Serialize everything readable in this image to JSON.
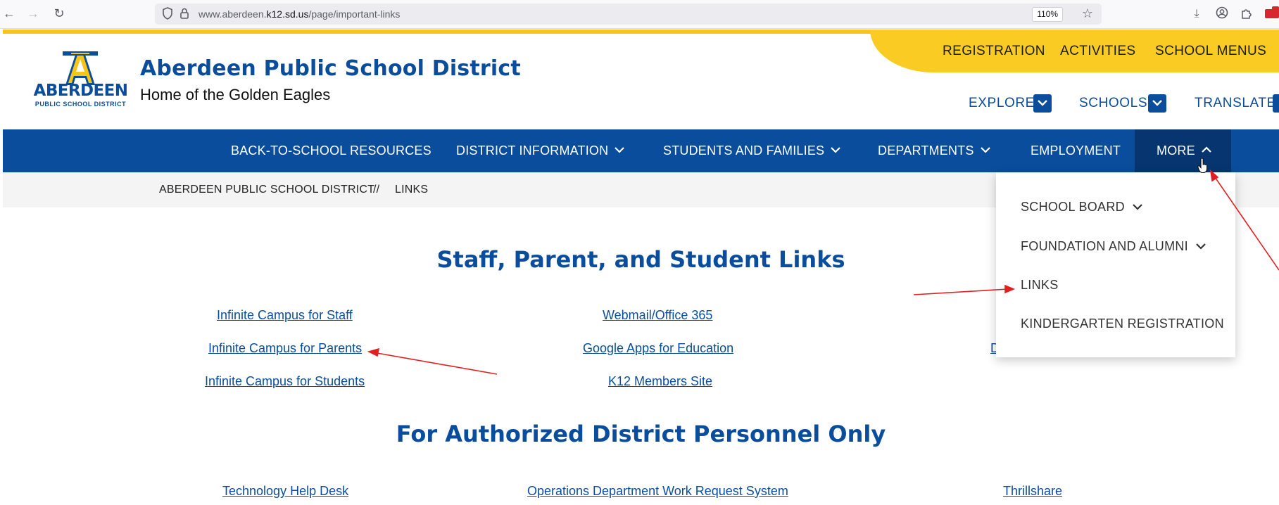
{
  "browser": {
    "url_prefix": "www.aberdeen.",
    "url_domain": "k12.sd.us",
    "url_path": "/page/important-links",
    "zoom": "110%"
  },
  "utility_nav": [
    "REGISTRATION",
    "ACTIVITIES",
    "SCHOOL MENUS"
  ],
  "logo": {
    "word": "ABERDEEN",
    "sub": "PUBLIC SCHOOL DISTRICT",
    "letter": "A"
  },
  "header": {
    "title": "Aberdeen Public School District",
    "tagline": "Home of the Golden Eagles"
  },
  "secondary_nav": [
    "EXPLORE",
    "SCHOOLS",
    "TRANSLATE"
  ],
  "main_nav": [
    "BACK-TO-SCHOOL RESOURCES",
    "DISTRICT INFORMATION",
    "STUDENTS AND FAMILIES",
    "DEPARTMENTS",
    "EMPLOYMENT",
    "MORE"
  ],
  "breadcrumb": {
    "root": "ABERDEEN PUBLIC SCHOOL DISTRICT",
    "sep": "//",
    "current": "LINKS"
  },
  "section1": {
    "heading": "Staff, Parent, and Student Links",
    "col1": [
      "Infinite Campus for Staff",
      "Infinite Campus for Parents",
      "Infinite Campus for Students"
    ],
    "col2": [
      "Webmail/Office 365",
      "Google Apps for Education",
      "K12 Members Site"
    ],
    "col3_partial": "D"
  },
  "section2": {
    "heading": "For Authorized District Personnel Only",
    "links": [
      "Technology Help Desk",
      "Operations Department Work Request System",
      "Thrillshare"
    ]
  },
  "more_menu": [
    "SCHOOL BOARD",
    "FOUNDATION AND ALUMNI",
    "LINKS",
    "KINDERGARTEN REGISTRATION"
  ],
  "colors": {
    "brand_blue": "#0a4d9c",
    "gold": "#f9cb23",
    "annotation_red": "#e02020"
  }
}
